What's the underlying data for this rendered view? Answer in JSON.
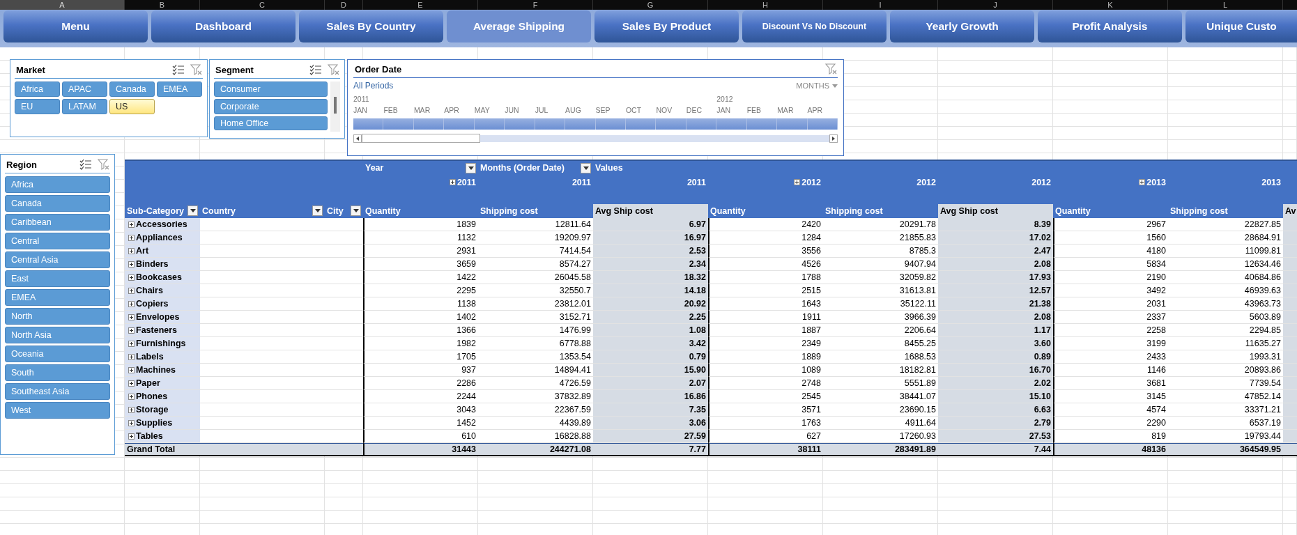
{
  "sheet": {
    "column_headers": [
      "A",
      "B",
      "C",
      "D",
      "E",
      "F",
      "G",
      "H",
      "I",
      "J",
      "K",
      "L"
    ]
  },
  "nav_buttons": [
    {
      "label": "Menu",
      "selected": false,
      "kind": "standard"
    },
    {
      "label": "Dashboard",
      "selected": false,
      "kind": "standard"
    },
    {
      "label": "Sales By Country",
      "selected": false,
      "kind": "standard"
    },
    {
      "label": "Average Shipping",
      "selected": true,
      "kind": "standard"
    },
    {
      "label": "Sales By Product",
      "selected": false,
      "kind": "standard"
    },
    {
      "label": "Discount Vs No Discount",
      "selected": false,
      "kind": "compact"
    },
    {
      "label": "Yearly Growth",
      "selected": false,
      "kind": "standard"
    },
    {
      "label": "Profit Analysis",
      "selected": false,
      "kind": "standard"
    },
    {
      "label": "Unique Custo",
      "selected": false,
      "kind": "standard"
    }
  ],
  "slicers": {
    "market": {
      "title": "Market",
      "items": [
        {
          "label": "Africa",
          "selected": false
        },
        {
          "label": "APAC",
          "selected": false
        },
        {
          "label": "Canada",
          "selected": false
        },
        {
          "label": "EMEA",
          "selected": false
        },
        {
          "label": "EU",
          "selected": false
        },
        {
          "label": "LATAM",
          "selected": false
        },
        {
          "label": "US",
          "selected": true
        }
      ]
    },
    "segment": {
      "title": "Segment",
      "items": [
        {
          "label": "Consumer",
          "selected": true
        },
        {
          "label": "Corporate",
          "selected": true
        },
        {
          "label": "Home Office",
          "selected": true
        }
      ]
    },
    "region": {
      "title": "Region",
      "items": [
        {
          "label": "Africa",
          "selected": true
        },
        {
          "label": "Canada",
          "selected": true
        },
        {
          "label": "Caribbean",
          "selected": true
        },
        {
          "label": "Central",
          "selected": true
        },
        {
          "label": "Central Asia",
          "selected": true
        },
        {
          "label": "East",
          "selected": true
        },
        {
          "label": "EMEA",
          "selected": true
        },
        {
          "label": "North",
          "selected": true
        },
        {
          "label": "North Asia",
          "selected": true
        },
        {
          "label": "Oceania",
          "selected": true
        },
        {
          "label": "South",
          "selected": true
        },
        {
          "label": "Southeast Asia",
          "selected": true
        },
        {
          "label": "West",
          "selected": true
        }
      ]
    }
  },
  "timeline": {
    "title": "Order Date",
    "period_label": "All Periods",
    "level_label": "MONTHS",
    "months": [
      {
        "label": "JAN",
        "year": "2011",
        "selected": true
      },
      {
        "label": "FEB",
        "selected": true
      },
      {
        "label": "MAR",
        "selected": true
      },
      {
        "label": "APR",
        "selected": true
      },
      {
        "label": "MAY",
        "selected": true
      },
      {
        "label": "JUN",
        "selected": true
      },
      {
        "label": "JUL",
        "selected": true
      },
      {
        "label": "AUG",
        "selected": true
      },
      {
        "label": "SEP",
        "selected": true
      },
      {
        "label": "OCT",
        "selected": true
      },
      {
        "label": "NOV",
        "selected": true
      },
      {
        "label": "DEC",
        "selected": true
      },
      {
        "label": "JAN",
        "year": "2012",
        "selected": true
      },
      {
        "label": "FEB",
        "selected": true
      },
      {
        "label": "MAR",
        "selected": true
      },
      {
        "label": "APR",
        "selected": true
      }
    ]
  },
  "pivot": {
    "column_fields": [
      {
        "label": "Year",
        "has_filter": true
      },
      {
        "label": "Months (Order Date)",
        "has_filter": true
      },
      {
        "label": "Values",
        "has_filter": false
      }
    ],
    "year_labels": [
      {
        "label": "2011",
        "expandable": true
      },
      {
        "label": "2011",
        "expandable": false
      },
      {
        "label": "2011",
        "expandable": false
      },
      {
        "label": "2012",
        "expandable": true
      },
      {
        "label": "2012",
        "expandable": false
      },
      {
        "label": "2012",
        "expandable": false
      },
      {
        "label": "2013",
        "expandable": true
      },
      {
        "label": "2013",
        "expandable": false
      }
    ],
    "row_fields": [
      {
        "label": "Sub-Category"
      },
      {
        "label": "Country"
      },
      {
        "label": "City"
      }
    ],
    "value_columns": [
      {
        "label": "Quantity",
        "kind": "sum"
      },
      {
        "label": "Shipping cost",
        "kind": "sum"
      },
      {
        "label": "Avg Ship cost",
        "kind": "average"
      },
      {
        "label": "Quantity",
        "kind": "sum"
      },
      {
        "label": "Shipping cost",
        "kind": "sum"
      },
      {
        "label": "Avg Ship cost",
        "kind": "average"
      },
      {
        "label": "Quantity",
        "kind": "sum"
      },
      {
        "label": "Shipping cost",
        "kind": "sum"
      },
      {
        "label": "Av",
        "kind": "average"
      }
    ],
    "rows": [
      {
        "name": "Accessories",
        "values": [
          "1839",
          "12811.64",
          "6.97",
          "2420",
          "20291.78",
          "8.39",
          "2967",
          "22827.85"
        ]
      },
      {
        "name": "Appliances",
        "values": [
          "1132",
          "19209.97",
          "16.97",
          "1284",
          "21855.83",
          "17.02",
          "1560",
          "28684.91"
        ]
      },
      {
        "name": "Art",
        "values": [
          "2931",
          "7414.54",
          "2.53",
          "3556",
          "8785.3",
          "2.47",
          "4180",
          "11099.81"
        ]
      },
      {
        "name": "Binders",
        "values": [
          "3659",
          "8574.27",
          "2.34",
          "4526",
          "9407.94",
          "2.08",
          "5834",
          "12634.46"
        ]
      },
      {
        "name": "Bookcases",
        "values": [
          "1422",
          "26045.58",
          "18.32",
          "1788",
          "32059.82",
          "17.93",
          "2190",
          "40684.86"
        ]
      },
      {
        "name": "Chairs",
        "values": [
          "2295",
          "32550.7",
          "14.18",
          "2515",
          "31613.81",
          "12.57",
          "3492",
          "46939.63"
        ]
      },
      {
        "name": "Copiers",
        "values": [
          "1138",
          "23812.01",
          "20.92",
          "1643",
          "35122.11",
          "21.38",
          "2031",
          "43963.73"
        ]
      },
      {
        "name": "Envelopes",
        "values": [
          "1402",
          "3152.71",
          "2.25",
          "1911",
          "3966.39",
          "2.08",
          "2337",
          "5603.89"
        ]
      },
      {
        "name": "Fasteners",
        "values": [
          "1366",
          "1476.99",
          "1.08",
          "1887",
          "2206.64",
          "1.17",
          "2258",
          "2294.85"
        ]
      },
      {
        "name": "Furnishings",
        "values": [
          "1982",
          "6778.88",
          "3.42",
          "2349",
          "8455.25",
          "3.60",
          "3199",
          "11635.27"
        ]
      },
      {
        "name": "Labels",
        "values": [
          "1705",
          "1353.54",
          "0.79",
          "1889",
          "1688.53",
          "0.89",
          "2433",
          "1993.31"
        ]
      },
      {
        "name": "Machines",
        "values": [
          "937",
          "14894.41",
          "15.90",
          "1089",
          "18182.81",
          "16.70",
          "1146",
          "20893.86"
        ]
      },
      {
        "name": "Paper",
        "values": [
          "2286",
          "4726.59",
          "2.07",
          "2748",
          "5551.89",
          "2.02",
          "3681",
          "7739.54"
        ]
      },
      {
        "name": "Phones",
        "values": [
          "2244",
          "37832.89",
          "16.86",
          "2545",
          "38441.07",
          "15.10",
          "3145",
          "47852.14"
        ]
      },
      {
        "name": "Storage",
        "values": [
          "3043",
          "22367.59",
          "7.35",
          "3571",
          "23690.15",
          "6.63",
          "4574",
          "33371.21"
        ]
      },
      {
        "name": "Supplies",
        "values": [
          "1452",
          "4439.89",
          "3.06",
          "1763",
          "4911.64",
          "2.79",
          "2290",
          "6537.19"
        ]
      },
      {
        "name": "Tables",
        "values": [
          "610",
          "16828.88",
          "27.59",
          "627",
          "17260.93",
          "27.53",
          "819",
          "19793.44"
        ]
      }
    ],
    "grand_total": {
      "label": "Grand Total",
      "values": [
        "31443",
        "244271.08",
        "7.77",
        "38111",
        "283491.89",
        "7.44",
        "48136",
        "364549.95"
      ]
    }
  }
}
